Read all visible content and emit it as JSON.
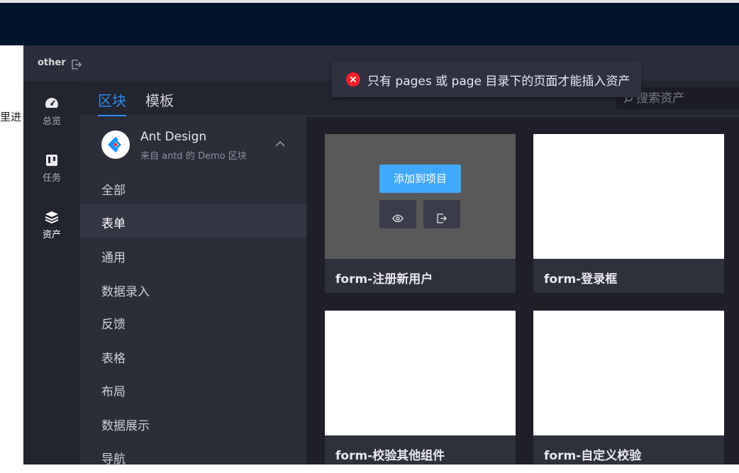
{
  "panel": {
    "title": "other"
  },
  "background": {
    "fragment": "里进"
  },
  "rail": [
    {
      "label": "总览",
      "icon": "dashboard-icon"
    },
    {
      "label": "任务",
      "icon": "tasks-icon"
    },
    {
      "label": "资产",
      "icon": "assets-icon"
    }
  ],
  "tabs": [
    {
      "label": "区块",
      "active": true
    },
    {
      "label": "模板",
      "active": false
    }
  ],
  "search": {
    "placeholder": "搜索资产"
  },
  "library": {
    "name": "Ant Design",
    "subtitle": "来自 antd 的 Demo 区块"
  },
  "categories": [
    {
      "label": "全部"
    },
    {
      "label": "表单",
      "active": true
    },
    {
      "label": "通用"
    },
    {
      "label": "数据录入"
    },
    {
      "label": "反馈"
    },
    {
      "label": "表格"
    },
    {
      "label": "布局"
    },
    {
      "label": "数据展示"
    },
    {
      "label": "导航"
    }
  ],
  "cards": [
    {
      "title": "form-注册新用户",
      "hovered": true
    },
    {
      "title": "form-登录框"
    },
    {
      "title": "form-校验其他组件"
    },
    {
      "title": "form-自定义校验"
    }
  ],
  "overlay": {
    "add_label": "添加到项目"
  },
  "toast": {
    "message": "只有 pages 或 page 目录下的页面才能插入资产"
  },
  "colors": {
    "accent": "#2d8cf0",
    "add_button": "#40a9ff",
    "error": "#f5222d",
    "topbar": "#00152a"
  }
}
